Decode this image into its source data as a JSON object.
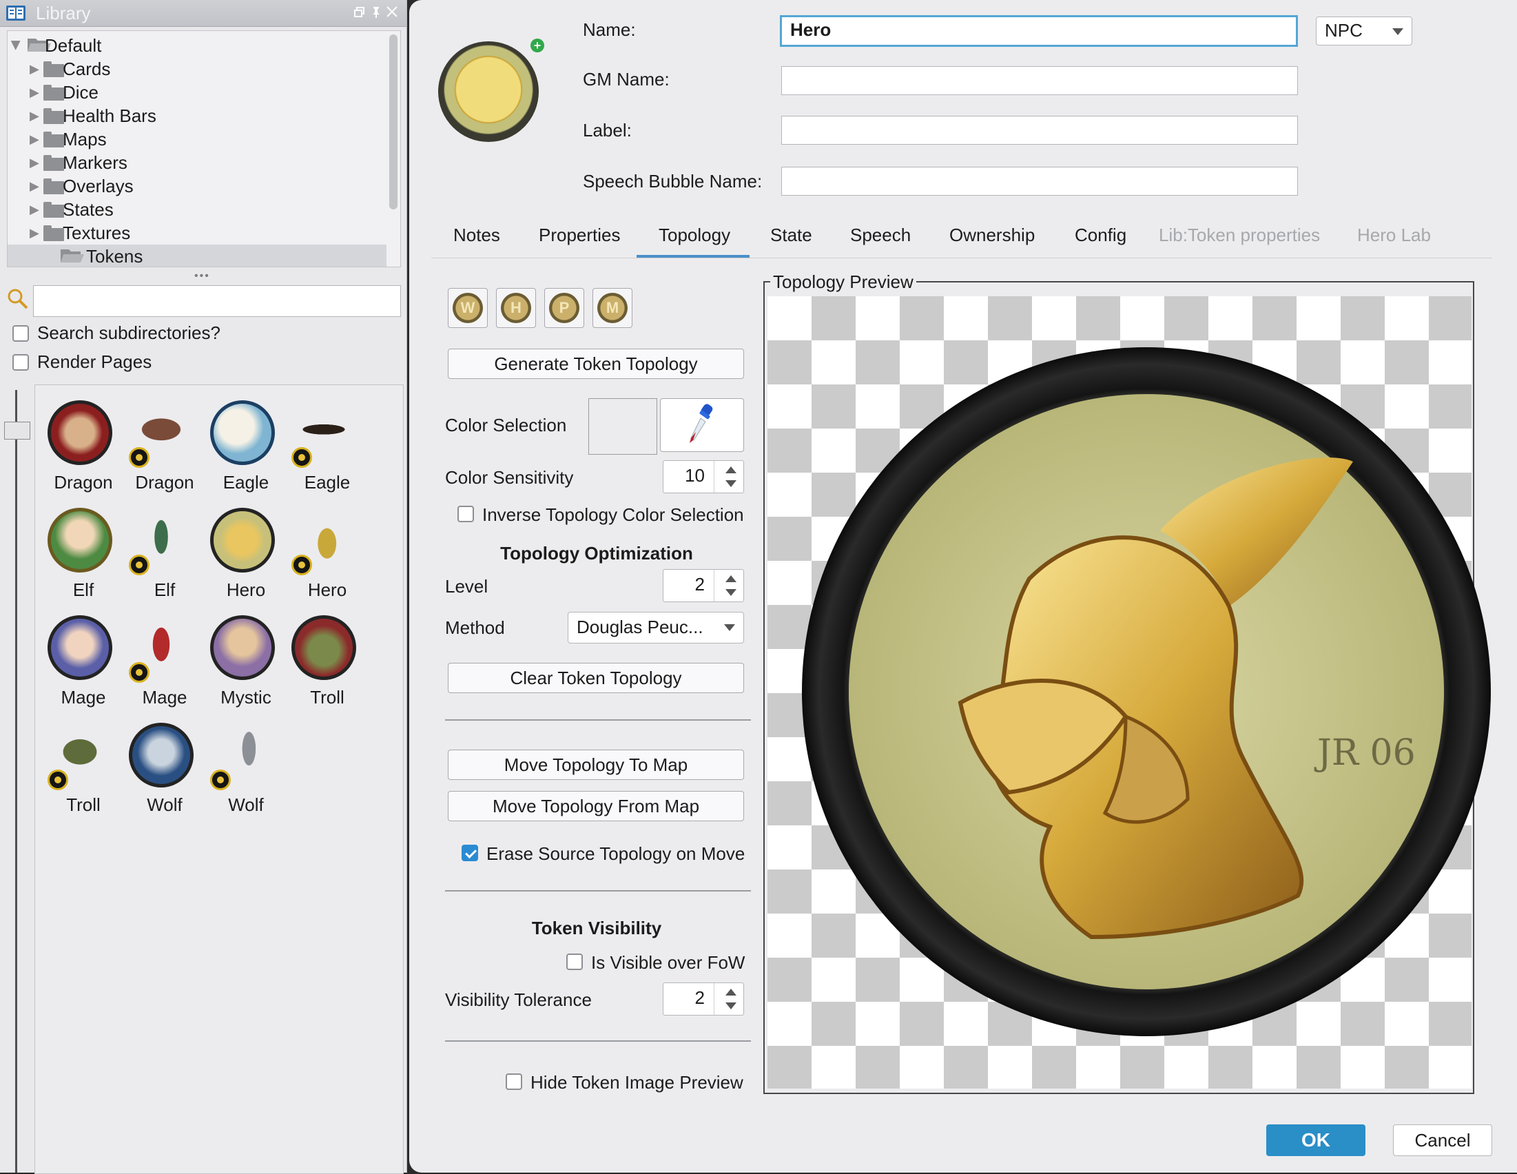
{
  "library": {
    "title": "Library",
    "tree": [
      {
        "label": "Default",
        "expanded": true
      },
      {
        "label": "Cards"
      },
      {
        "label": "Dice"
      },
      {
        "label": "Health Bars"
      },
      {
        "label": "Maps"
      },
      {
        "label": "Markers"
      },
      {
        "label": "Overlays"
      },
      {
        "label": "States"
      },
      {
        "label": "Textures"
      },
      {
        "label": "Tokens",
        "selected": true
      }
    ],
    "search": {
      "value": "",
      "placeholder": ""
    },
    "options": {
      "search_subdirectories": {
        "label": "Search subdirectories?",
        "checked": false
      },
      "render_pages": {
        "label": "Render Pages",
        "checked": false
      }
    },
    "thumbnails": [
      "Dragon",
      "Dragon",
      "Eagle",
      "Eagle",
      "Elf",
      "Elf",
      "Hero",
      "Hero",
      "Mage",
      "Mage",
      "Mystic",
      "Troll",
      "Troll",
      "Wolf",
      "Wolf"
    ]
  },
  "dialog": {
    "name_label": "Name:",
    "name_value": "Hero",
    "type_value": "NPC",
    "gm_name_label": "GM Name:",
    "gm_name_value": "",
    "label_label": "Label:",
    "label_value": "",
    "speech_label": "Speech Bubble Name:",
    "speech_value": "",
    "tabs": [
      "Notes",
      "Properties",
      "Topology",
      "State",
      "Speech",
      "Ownership",
      "Config",
      "Lib:Token properties",
      "Hero Lab"
    ],
    "active_tab": "Topology",
    "topology": {
      "type_buttons": [
        "W",
        "H",
        "P",
        "M"
      ],
      "generate_label": "Generate Token Topology",
      "color_selection_label": "Color Selection",
      "color_sensitivity_label": "Color Sensitivity",
      "color_sensitivity_value": "10",
      "inverse_label": "Inverse Topology Color Selection",
      "inverse_checked": false,
      "optimization_title": "Topology Optimization",
      "level_label": "Level",
      "level_value": "2",
      "method_label": "Method",
      "method_value": "Douglas Peuc...",
      "clear_label": "Clear Token Topology",
      "move_to_map_label": "Move Topology To Map",
      "move_from_map_label": "Move Topology From Map",
      "erase_label": "Erase Source Topology on Move",
      "erase_checked": true,
      "visibility_title": "Token Visibility",
      "visible_fow_label": "Is Visible over FoW",
      "visible_fow_checked": false,
      "tolerance_label": "Visibility Tolerance",
      "tolerance_value": "2",
      "hide_preview_label": "Hide Token Image Preview",
      "hide_preview_checked": false,
      "preview_title": "Topology Preview"
    },
    "ok_label": "OK",
    "cancel_label": "Cancel"
  },
  "colors": {
    "accent": "#2a8ec7",
    "focus_ring": "#54a6d4",
    "checkbox_checked": "#2b8bd2"
  }
}
